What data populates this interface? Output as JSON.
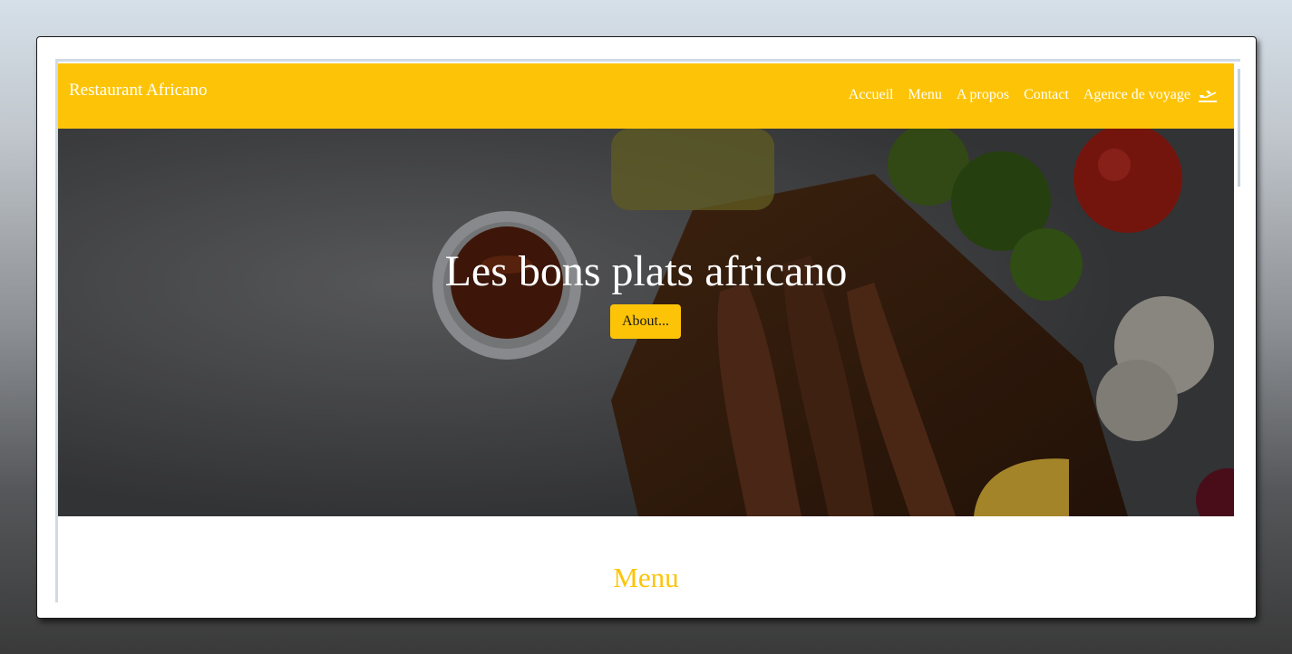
{
  "navbar": {
    "brand": "Restaurant Africano",
    "links": [
      "Accueil",
      "Menu",
      "A propos",
      "Contact",
      "Agence de voyage"
    ],
    "travel_icon": "plane-departure-icon"
  },
  "hero": {
    "title": "Les bons plats africano",
    "button_label": "About..."
  },
  "menu_section": {
    "title": "Menu"
  },
  "colors": {
    "accent": "#fdc407",
    "hero_overlay": "#5b5c5e",
    "text_light": "#ffffff"
  }
}
